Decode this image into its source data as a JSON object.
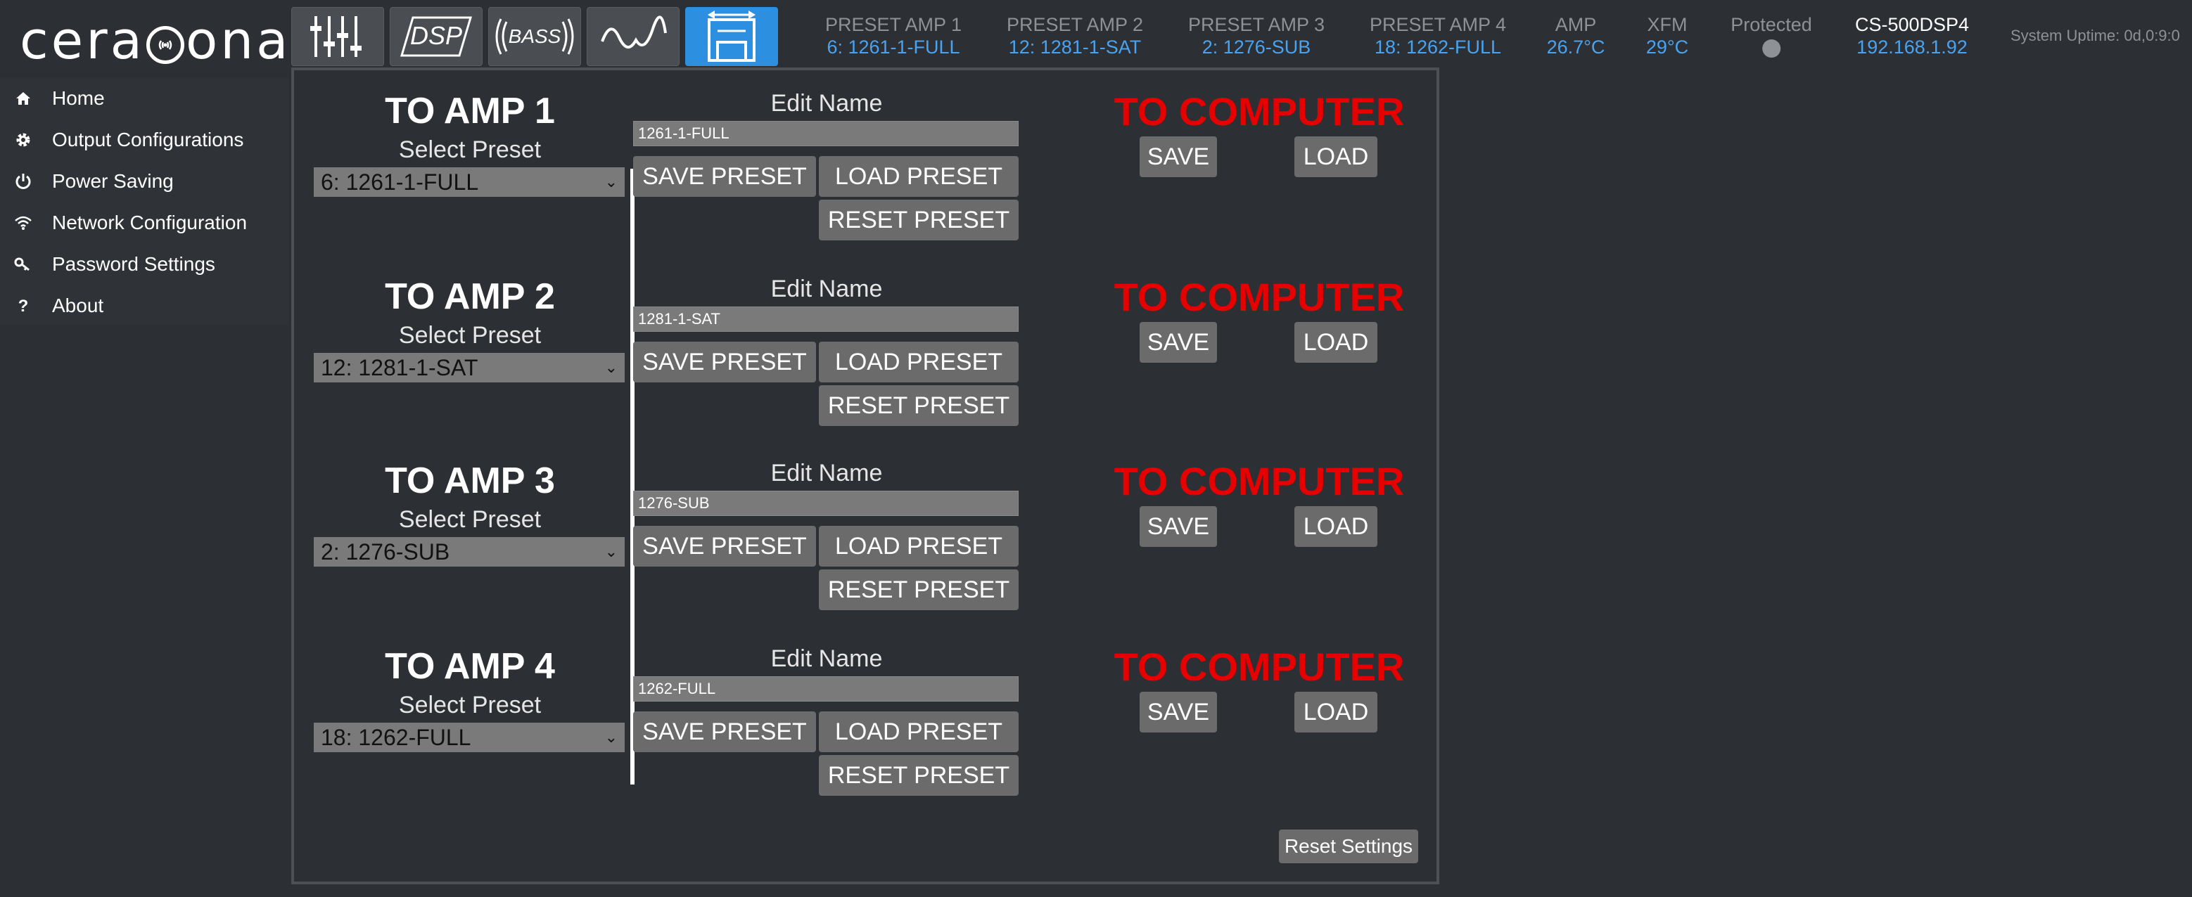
{
  "brand": {
    "name_pre": "cera",
    "name_post": "onar"
  },
  "toolbar": {
    "items": [
      {
        "icon": "sliders-icon",
        "label": ""
      },
      {
        "icon": "dsp-icon",
        "label": "DSP"
      },
      {
        "icon": "bass-icon",
        "label": "BASS"
      },
      {
        "icon": "waveform-icon",
        "label": ""
      },
      {
        "icon": "preset-transfer-icon",
        "label": "",
        "active": true
      }
    ]
  },
  "status": {
    "preset_amp1": {
      "label": "PRESET AMP 1",
      "value": "6: 1261-1-FULL"
    },
    "preset_amp2": {
      "label": "PRESET AMP 2",
      "value": "12: 1281-1-SAT"
    },
    "preset_amp3": {
      "label": "PRESET AMP 3",
      "value": "2: 1276-SUB"
    },
    "preset_amp4": {
      "label": "PRESET AMP 4",
      "value": "18: 1262-FULL"
    },
    "amp": {
      "label": "AMP",
      "value": "26.7°C"
    },
    "xfm": {
      "label": "XFM",
      "value": "29°C"
    },
    "protected": {
      "label": "Protected"
    },
    "device": {
      "label": "CS-500DSP4",
      "value": "192.168.1.92"
    },
    "uptime": "System Uptime: 0d,0:9:0"
  },
  "sidebar": {
    "items": [
      {
        "label": "Home",
        "icon": "home-icon"
      },
      {
        "label": "Output Configurations",
        "icon": "gear-icon"
      },
      {
        "label": "Power Saving",
        "icon": "power-icon"
      },
      {
        "label": "Network Configuration",
        "icon": "wifi-icon"
      },
      {
        "label": "Password Settings",
        "icon": "key-icon"
      },
      {
        "label": "About",
        "icon": "question-icon"
      }
    ]
  },
  "amps": [
    {
      "title": "TO AMP 1",
      "select_label": "Select Preset",
      "selected": "6: 1261-1-FULL",
      "edit_label": "Edit Name",
      "name": "1261-1-FULL"
    },
    {
      "title": "TO AMP 2",
      "select_label": "Select Preset",
      "selected": "12: 1281-1-SAT",
      "edit_label": "Edit Name",
      "name": "1281-1-SAT"
    },
    {
      "title": "TO AMP 3",
      "select_label": "Select Preset",
      "selected": "2: 1276-SUB",
      "edit_label": "Edit Name",
      "name": "1276-SUB"
    },
    {
      "title": "TO AMP 4",
      "select_label": "Select Preset",
      "selected": "18: 1262-FULL",
      "edit_label": "Edit Name",
      "name": "1262-FULL"
    }
  ],
  "buttons": {
    "save_preset": "SAVE PRESET",
    "load_preset": "LOAD PRESET",
    "reset_preset": "RESET PRESET",
    "to_computer": "TO COMPUTER",
    "save": "SAVE",
    "load": "LOAD",
    "reset_settings": "Reset Settings"
  },
  "colors": {
    "accent": "#2d8fe0",
    "alert": "#e60000",
    "value": "#4aa3f0"
  }
}
